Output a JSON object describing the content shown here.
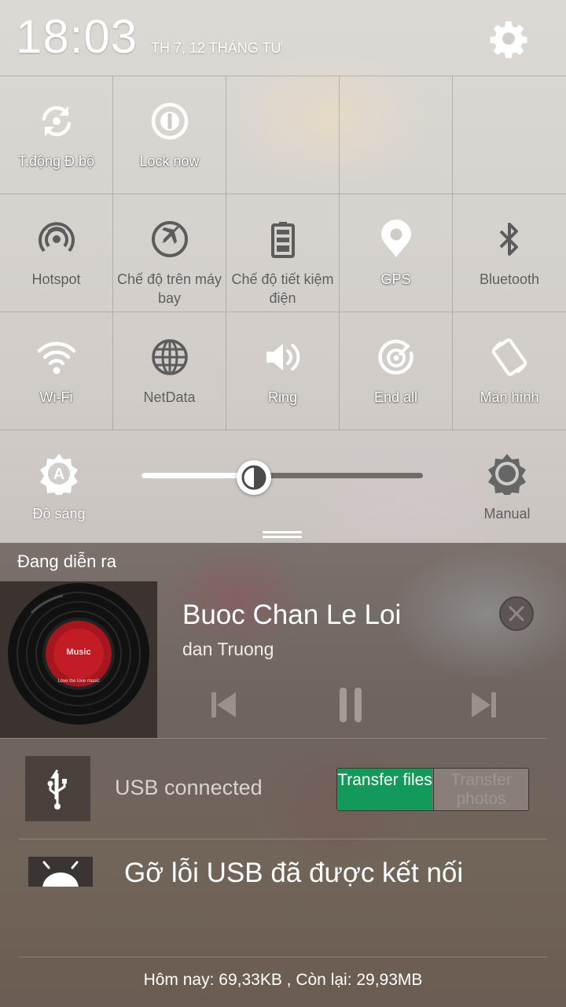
{
  "status": {
    "time": "18:03",
    "date": "TH 7, 12 THÁNG TƯ"
  },
  "quick_settings": {
    "row1": [
      {
        "label": "T.động Đ.bộ",
        "icon": "sync-icon"
      },
      {
        "label": "Lock now",
        "icon": "lock-now-icon"
      }
    ],
    "row2": [
      {
        "label": "Hotspot",
        "icon": "hotspot-icon",
        "state": "off"
      },
      {
        "label": "Chế độ trên máy bay",
        "icon": "airplane-icon",
        "state": "off"
      },
      {
        "label": "Chế độ tiết kiệm điện",
        "icon": "battery-saver-icon",
        "state": "off"
      },
      {
        "label": "GPS",
        "icon": "gps-icon",
        "state": "on"
      },
      {
        "label": "Bluetooth",
        "icon": "bluetooth-icon",
        "state": "off"
      }
    ],
    "row3": [
      {
        "label": "Wi-Fi",
        "icon": "wifi-icon",
        "state": "on"
      },
      {
        "label": "NetData",
        "icon": "globe-icon",
        "state": "off"
      },
      {
        "label": "Ring",
        "icon": "speaker-icon",
        "state": "on"
      },
      {
        "label": "End all",
        "icon": "end-all-icon",
        "state": "on"
      },
      {
        "label": "Màn hình",
        "icon": "rotate-screen-icon",
        "state": "on"
      }
    ],
    "brightness": {
      "label": "Độ sáng",
      "level": 0.4,
      "mode_label": "Manual"
    }
  },
  "notifications": {
    "section_title": "Đang diễn ra",
    "music": {
      "album_label": "Music",
      "album_ring_text": "Love the love music",
      "title": "Buoc Chan Le Loi",
      "artist": "dan Truong"
    },
    "usb": {
      "text": "USB connected",
      "transfer_files": "Transfer files",
      "transfer_photos": "Transfer photos"
    },
    "debug": {
      "text": "Gỡ lỗi USB đã được kết nối"
    },
    "data_usage": "Hôm nay: 69,33KB , Còn lại: 29,93MB"
  },
  "colors": {
    "accent_green": "#139a5a",
    "on_text": "#ffffff",
    "off_text": "#5c5c5c"
  }
}
